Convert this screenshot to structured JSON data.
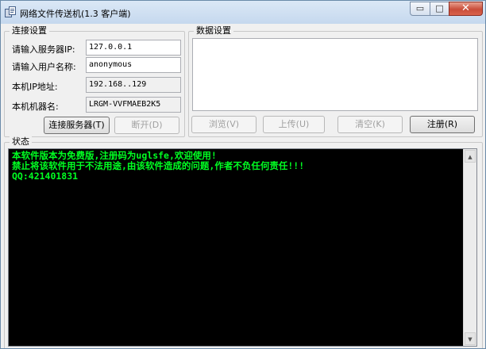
{
  "window": {
    "title": "网络文件传送机(1.3  客户端)",
    "controls": {
      "minimize": "▭",
      "maximize": "□",
      "close": "✕"
    }
  },
  "connection": {
    "group_label": "连接设置",
    "server_ip_label": "请输入服务器IP:",
    "server_ip_value": "127.0.0.1",
    "user_name_label": "请输入用户名称:",
    "user_name_value": "anonymous",
    "local_ip_label": "本机IP地址:",
    "local_ip_value": "192.168..129",
    "machine_name_label": "本机机器名:",
    "machine_name_value": "LRGM-VVFMAEB2K5",
    "connect_button": "连接服务器(T)",
    "disconnect_button": "断开(D)"
  },
  "data_settings": {
    "group_label": "数据设置",
    "browse_button": "浏览(V)",
    "upload_button": "上传(U)",
    "clear_button": "清空(K)",
    "register_button": "注册(R)"
  },
  "status": {
    "group_label": "状态",
    "lines": [
      "本软件版本为免费版,注册码为uglsfe,欢迎使用!",
      "禁止将该软件用于不法用途,由该软件造成的问题,作者不负任何责任!!!",
      "QQ:421401831"
    ]
  },
  "icons": {
    "app": "app-icon",
    "scroll_up": "scroll-up-icon",
    "scroll_down": "scroll-down-icon"
  },
  "colors": {
    "console_bg": "#000000",
    "console_text": "#00ff22",
    "close_button": "#c94d3a"
  }
}
